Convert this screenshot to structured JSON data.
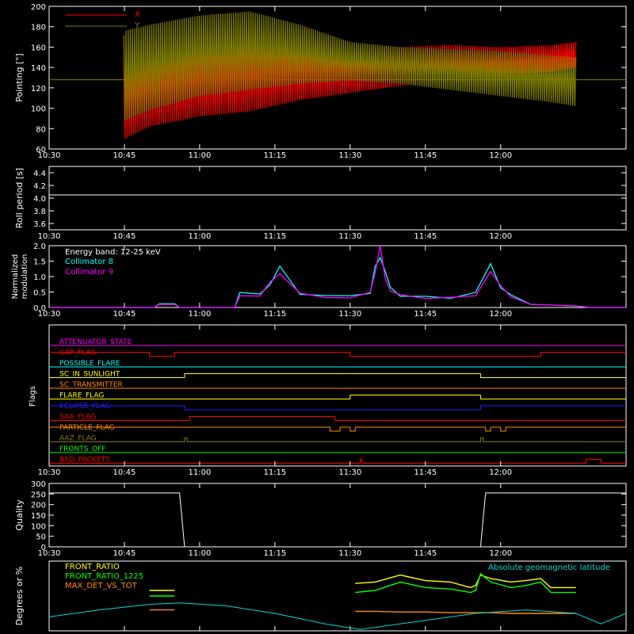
{
  "colors": {
    "background": "#000000",
    "axes": "#ffffff",
    "x_pointing": "#ff0000",
    "y_pointing": "#808000",
    "roll": "#ffffff",
    "coll8": "#00ffff",
    "coll9": "#ff00ff",
    "front_ratio": "#ffff00",
    "front_ratio_1225": "#00ff00",
    "max_det": "#ff8c00",
    "geomag": "#00d8d8"
  },
  "time_axis": {
    "ticks": [
      "10:30",
      "10:45",
      "11:00",
      "11:15",
      "11:30",
      "11:45",
      "12:00"
    ],
    "range_min": [
      0,
      115
    ]
  },
  "panels": {
    "pointing": {
      "ylabel": "Pointing [\"]",
      "yticks": [
        "60",
        "80",
        "100",
        "120",
        "140",
        "160",
        "180",
        "200"
      ],
      "ylim": [
        60,
        200
      ],
      "legend": [
        "X",
        "Y"
      ]
    },
    "roll": {
      "ylabel": "Roll period [s]",
      "yticks": [
        "3.6",
        "3.8",
        "4.0",
        "4.2",
        "4.4"
      ],
      "ylim": [
        3.5,
        4.5
      ]
    },
    "modulation": {
      "ylabel_line1": "Normalized",
      "ylabel_line2": "modulation",
      "yticks": [
        "0.0",
        "0.5",
        "1.0",
        "1.5",
        "2.0"
      ],
      "ylim": [
        0,
        2
      ],
      "legend_title": "Energy band: 12-25 keV",
      "legend": [
        "Collimator 8",
        "Collimator 9"
      ]
    },
    "flags": {
      "ylabel": "Flags"
    },
    "quality": {
      "ylabel": "Quality",
      "yticks": [
        "0",
        "50",
        "100",
        "150",
        "200",
        "250",
        "300"
      ],
      "ylim": [
        0,
        300
      ]
    },
    "ratios": {
      "ylabel": "Degrees or %",
      "legend": [
        "FRONT_RATIO",
        "FRONT_RATIO_1225",
        "MAX_DET_VS_TOT"
      ],
      "right_legend": "Absolute geomagnetic latitude"
    }
  },
  "chart_data": [
    {
      "type": "line",
      "panel": "pointing",
      "x_unit": "minutes after 10:30",
      "series": [
        {
          "name": "X",
          "envelope_x": [
            14,
            15,
            20,
            30,
            40,
            50,
            60,
            70,
            80,
            90,
            100,
            105
          ],
          "upper": [
            180,
            145,
            150,
            158,
            162,
            160,
            158,
            160,
            162,
            160,
            162,
            165
          ],
          "lower": [
            130,
            70,
            82,
            92,
            97,
            108,
            115,
            122,
            128,
            133,
            136,
            140
          ]
        },
        {
          "name": "Y",
          "envelope_x": [
            14,
            15,
            20,
            30,
            40,
            50,
            60,
            70,
            80,
            90,
            100,
            105
          ],
          "upper": [
            130,
            176,
            182,
            191,
            195,
            182,
            165,
            160,
            158,
            156,
            152,
            150
          ],
          "lower": [
            128,
            88,
            98,
            112,
            118,
            124,
            127,
            124,
            118,
            112,
            106,
            102
          ]
        }
      ],
      "y_outside": 128
    },
    {
      "type": "line",
      "panel": "roll",
      "x_unit": "minutes after 10:30",
      "x": [
        0,
        115
      ],
      "y": [
        4.05,
        4.05
      ]
    },
    {
      "type": "line",
      "panel": "modulation",
      "x_unit": "minutes after 10:30",
      "x": [
        0,
        21,
        22,
        25,
        26,
        37,
        38,
        42,
        44,
        46,
        50,
        55,
        60,
        64,
        65,
        66,
        67,
        68,
        70,
        75,
        80,
        85,
        88,
        90,
        92,
        96,
        100,
        105,
        108,
        110,
        115
      ],
      "series": [
        {
          "name": "Collimator 8",
          "values": [
            0,
            0,
            0.12,
            0.12,
            0,
            0,
            0.5,
            0.4,
            0.8,
            1.3,
            0.5,
            0.4,
            0.35,
            0.5,
            1.3,
            1.9,
            1.2,
            0.6,
            0.4,
            0.35,
            0.35,
            0.5,
            1.3,
            0.7,
            0.4,
            0.1,
            0.08,
            0.05,
            0,
            0,
            0
          ]
        },
        {
          "name": "Collimator 9",
          "values": [
            0,
            0,
            0.1,
            0.1,
            0,
            0,
            0.45,
            0.38,
            0.75,
            1.2,
            0.45,
            0.38,
            0.32,
            0.45,
            1.25,
            2.0,
            1.1,
            0.55,
            0.38,
            0.32,
            0.32,
            0.45,
            1.2,
            0.65,
            0.38,
            0.1,
            0.08,
            0.05,
            0,
            0,
            0
          ]
        }
      ]
    },
    {
      "type": "line",
      "panel": "flags",
      "x_unit": "minutes after 10:30",
      "flags": [
        {
          "name": "ATTENUATOR_STATE",
          "color": "#ff00ff",
          "steps": [
            [
              0,
              0
            ],
            [
              115,
              0
            ]
          ]
        },
        {
          "name": "GAP_FLAG",
          "color": "#ff0000",
          "steps": [
            [
              0,
              1
            ],
            [
              20,
              0
            ],
            [
              25,
              1
            ],
            [
              60,
              0
            ],
            [
              98,
              1
            ],
            [
              115,
              1
            ]
          ]
        },
        {
          "name": "POSSIBLE_FLARE",
          "color": "#00ffff",
          "steps": [
            [
              0,
              0
            ],
            [
              115,
              0
            ]
          ]
        },
        {
          "name": "SC_IN_SUNLIGHT",
          "color": "#ffff00",
          "steps": [
            [
              0,
              0
            ],
            [
              27,
              1
            ],
            [
              86,
              0
            ],
            [
              115,
              0
            ]
          ]
        },
        {
          "name": "SC_TRANSMITTER",
          "color": "#ff8c00",
          "steps": [
            [
              0,
              0
            ],
            [
              115,
              0
            ]
          ]
        },
        {
          "name": "FLARE_FLAG",
          "color": "#ffff00",
          "steps": [
            [
              0,
              0
            ],
            [
              60,
              1
            ],
            [
              86,
              0
            ],
            [
              115,
              0
            ]
          ]
        },
        {
          "name": "ECLIPSE_FLAG",
          "color": "#2020ff",
          "steps": [
            [
              0,
              1
            ],
            [
              27,
              0
            ],
            [
              86,
              1
            ],
            [
              115,
              1
            ]
          ]
        },
        {
          "name": "SAA_FLAG",
          "color": "#ff0000",
          "steps": [
            [
              0,
              0
            ],
            [
              28,
              1
            ],
            [
              57,
              0
            ],
            [
              115,
              0
            ]
          ]
        },
        {
          "name": "PARTICLE_FLAG",
          "color": "#ff8c00",
          "steps": [
            [
              0,
              1
            ],
            [
              56,
              0
            ],
            [
              58,
              1
            ],
            [
              60,
              0
            ],
            [
              61,
              1
            ],
            [
              87,
              0
            ],
            [
              88,
              1
            ],
            [
              90,
              0
            ],
            [
              91,
              1
            ],
            [
              115,
              1
            ]
          ]
        },
        {
          "name": "AAZ_FLAG",
          "color": "#808000",
          "steps": [
            [
              0,
              0
            ],
            [
              27,
              1
            ],
            [
              27.5,
              0
            ],
            [
              86,
              1
            ],
            [
              86.5,
              0
            ],
            [
              115,
              0
            ]
          ]
        },
        {
          "name": "FRONTS_OFF",
          "color": "#00ff00",
          "steps": [
            [
              0,
              0
            ],
            [
              115,
              0
            ]
          ]
        },
        {
          "name": "BAD_PACKETS",
          "color": "#ff0000",
          "steps": [
            [
              0,
              0
            ],
            [
              62,
              1
            ],
            [
              62.3,
              0
            ],
            [
              107,
              1
            ],
            [
              110,
              0
            ],
            [
              115,
              0
            ]
          ]
        }
      ]
    },
    {
      "type": "line",
      "panel": "quality",
      "x_unit": "minutes after 10:30",
      "x": [
        0,
        26,
        27,
        28,
        85,
        86,
        87,
        115
      ],
      "y": [
        255,
        255,
        0,
        0,
        0,
        0,
        255,
        255
      ]
    },
    {
      "type": "line",
      "panel": "ratios",
      "x_unit": "minutes after 10:30",
      "x": [
        20,
        25,
        26,
        60,
        61,
        65,
        70,
        75,
        80,
        84,
        85,
        86,
        88,
        92,
        95,
        98,
        100,
        105
      ],
      "series": [
        {
          "name": "FRONT_RATIO",
          "values": [
            58,
            58,
            null,
            null,
            68,
            70,
            80,
            72,
            70,
            62,
            65,
            80,
            75,
            70,
            72,
            75,
            62,
            62
          ]
        },
        {
          "name": "FRONT_RATIO_1225",
          "values": [
            50,
            50,
            null,
            null,
            55,
            58,
            70,
            62,
            60,
            55,
            58,
            82,
            70,
            62,
            65,
            70,
            55,
            55
          ]
        },
        {
          "name": "MAX_DET_VS_TOT",
          "values": [
            30,
            30,
            null,
            null,
            28,
            28,
            27,
            27,
            26,
            26,
            26,
            26,
            26,
            25,
            25,
            25,
            25,
            25
          ]
        }
      ],
      "geomag": {
        "name": "Absolute geomagnetic latitude",
        "x": [
          0,
          10,
          20,
          26,
          35,
          45,
          55,
          62,
          65,
          75,
          85,
          95,
          105,
          110,
          115
        ],
        "y": [
          20,
          30,
          38,
          40,
          36,
          25,
          10,
          2,
          5,
          15,
          25,
          30,
          25,
          10,
          25
        ]
      }
    }
  ]
}
